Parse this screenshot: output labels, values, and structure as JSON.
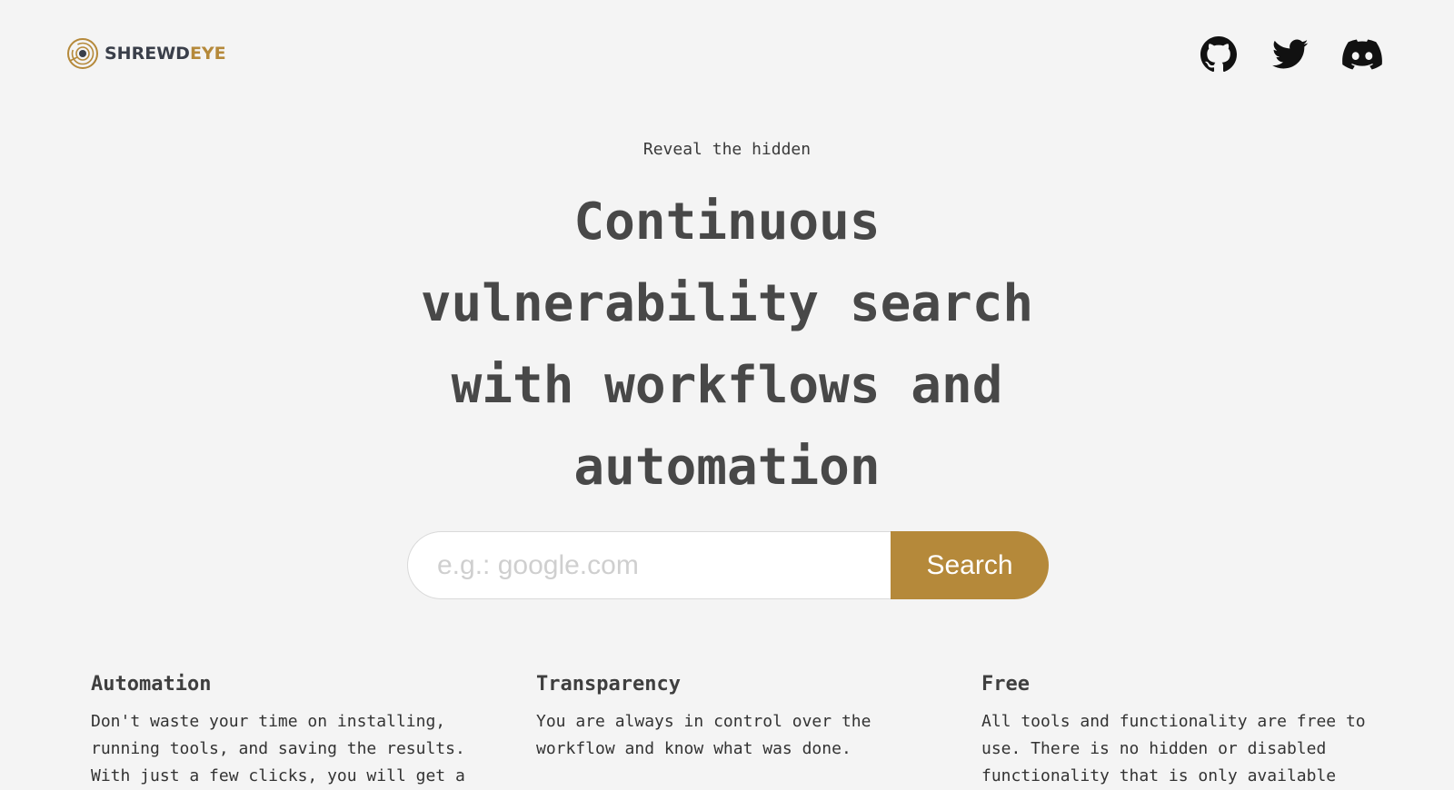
{
  "brand": {
    "name_part1": "SHREWD",
    "name_part2": "EYE",
    "color_dark": "#3a3f4a",
    "color_accent": "#b5893a"
  },
  "social": [
    {
      "icon": "github-icon"
    },
    {
      "icon": "twitter-icon"
    },
    {
      "icon": "discord-icon"
    }
  ],
  "hero": {
    "tagline": "Reveal the hidden",
    "headline": "Continuous vulnerability search with workflows and automation"
  },
  "search": {
    "placeholder": "e.g.: google.com",
    "value": "",
    "button_label": "Search"
  },
  "features": [
    {
      "title": "Automation",
      "text": "Don't waste your time on installing, running tools, and saving the results. With just a few clicks, you will get a"
    },
    {
      "title": "Transparency",
      "text": "You are always in control over the workflow and know what was done."
    },
    {
      "title": "Free",
      "text": "All tools and functionality are free to use. There is no hidden or disabled functionality that is only available"
    }
  ]
}
